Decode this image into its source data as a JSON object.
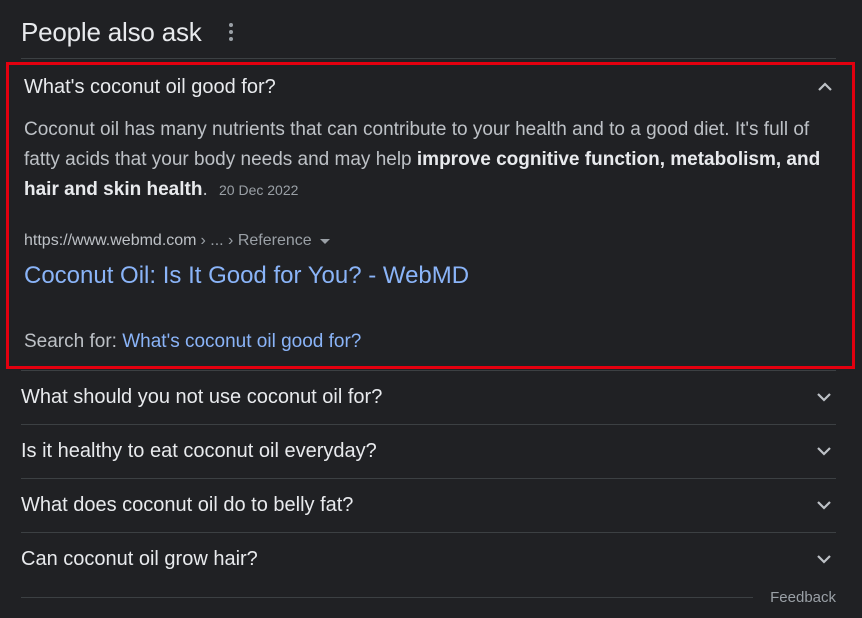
{
  "header": {
    "title": "People also ask"
  },
  "expanded_item": {
    "question": "What's coconut oil good for?",
    "answer_part1": "Coconut oil has many nutrients that can contribute to your health and to a good diet. It's full of fatty acids that your body needs and may help ",
    "answer_bold": "improve cognitive function, metabolism, and hair and skin health",
    "answer_part2": ".",
    "date": "20 Dec 2022",
    "source_domain": "https://www.webmd.com",
    "source_crumbs": "› ... › Reference",
    "result_title": "Coconut Oil: Is It Good for You? - WebMD",
    "search_for_label": "Search for:",
    "search_for_query": "What's coconut oil good for?"
  },
  "questions": [
    "What should you not use coconut oil for?",
    "Is it healthy to eat coconut oil everyday?",
    "What does coconut oil do to belly fat?",
    "Can coconut oil grow hair?"
  ],
  "footer": {
    "feedback_label": "Feedback"
  },
  "colors": {
    "background": "#202124",
    "link": "#8ab4f8",
    "highlight_border": "#e3000f"
  },
  "icons": {
    "more": "more-vert-icon",
    "expanded": "chevron-up-icon",
    "collapsed": "chevron-down-icon"
  }
}
